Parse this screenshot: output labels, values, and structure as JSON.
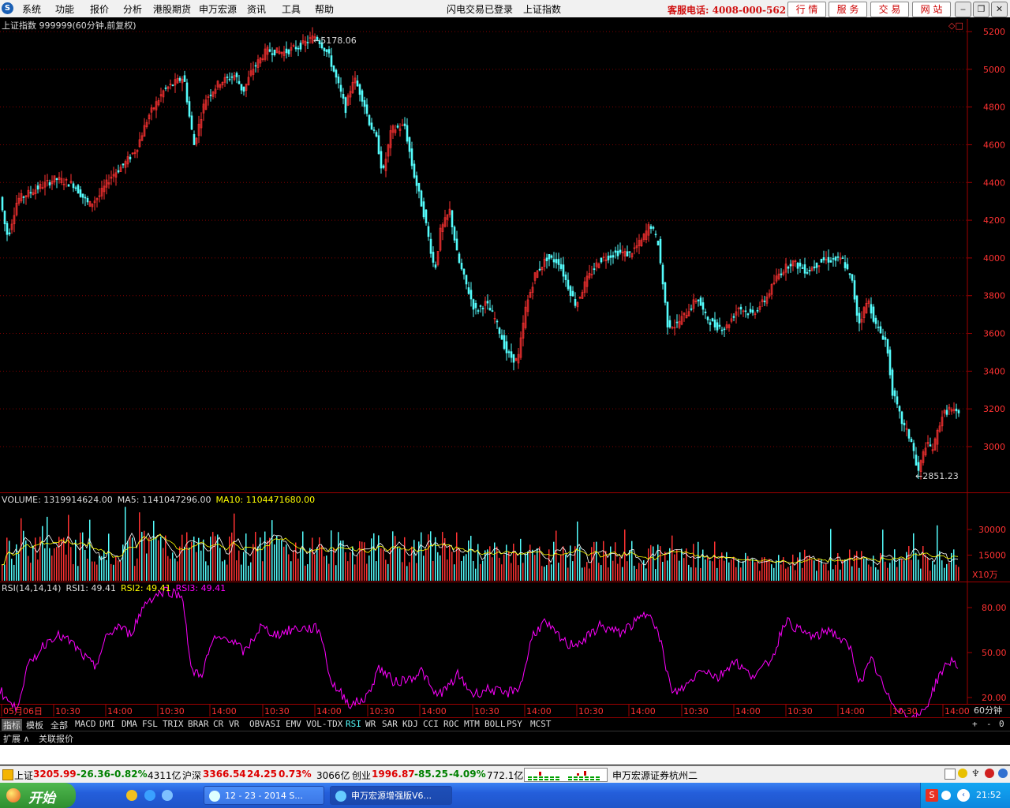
{
  "menu": {
    "items": [
      "系统",
      "功能",
      "报价",
      "分析",
      "港股期货",
      "申万宏源",
      "资讯",
      "工具",
      "帮助"
    ],
    "status_center": "闪电交易已登录",
    "current_security": "上证指数",
    "hotline": "客服电话: 4008-000-562",
    "right_buttons": [
      "行 情",
      "服 务",
      "交 易",
      "网 站"
    ]
  },
  "window_buttons": {
    "minimize": "‒",
    "restore": "❐",
    "close": "✕"
  },
  "chart": {
    "title": "上证指数 999999(60分钟,前复权)",
    "high_label": "5178.06",
    "low_label": "2851.23",
    "corner_mark": "◇□",
    "price_ticks": [
      "5200",
      "5000",
      "4800",
      "4600",
      "4400",
      "4200",
      "4000",
      "3800",
      "3600",
      "3400",
      "3200",
      "3000"
    ],
    "volume": {
      "label": "VOLUME: 1319914624.00",
      "ma5_label": "MA5: 1141047296.00",
      "ma10_label": "MA10: 1104471680.00",
      "ticks": [
        "30000",
        "15000"
      ],
      "unit": "X10万"
    },
    "rsi": {
      "label": "RSI(14,14,14)",
      "rsi1": "RSI1: 49.41",
      "rsi2": "RSI2: 49.41",
      "rsi3": "RSI3: 49.41",
      "ticks": [
        "80.00",
        "50.00",
        "20.00"
      ]
    },
    "time_labels": [
      "05月06日",
      "10:30",
      "14:00",
      "10:30",
      "14:00",
      "10:30",
      "14:00",
      "10:30",
      "14:00",
      "10:30",
      "14:00",
      "10:30",
      "14:00",
      "10:30",
      "14:00",
      "10:30",
      "14:00",
      "10:30",
      "14:00"
    ],
    "period": "60分钟"
  },
  "colors": {
    "up": "#ff3232",
    "down": "#54fcfc",
    "ma5": "#ffffff",
    "ma10": "#ffff00",
    "rsi": "#ff00ff",
    "grid": "#800000",
    "axis_text": "#ff3232"
  },
  "chart_data": {
    "type": "candlestick",
    "title": "上证指数 999999(60分钟,前复权)",
    "ylim": [
      2800,
      5250
    ],
    "price_path": [
      [
        0,
        4370
      ],
      [
        8,
        4180
      ],
      [
        12,
        4110
      ],
      [
        24,
        4310
      ],
      [
        45,
        4360
      ],
      [
        72,
        4420
      ],
      [
        95,
        4390
      ],
      [
        115,
        4280
      ],
      [
        128,
        4330
      ],
      [
        142,
        4430
      ],
      [
        160,
        4500
      ],
      [
        175,
        4580
      ],
      [
        190,
        4750
      ],
      [
        210,
        4890
      ],
      [
        235,
        4960
      ],
      [
        242,
        4750
      ],
      [
        248,
        4600
      ],
      [
        262,
        4840
      ],
      [
        280,
        4930
      ],
      [
        300,
        4970
      ],
      [
        310,
        4880
      ],
      [
        322,
        5000
      ],
      [
        340,
        5100
      ],
      [
        362,
        5090
      ],
      [
        385,
        5130
      ],
      [
        402,
        5178
      ],
      [
        418,
        5080
      ],
      [
        432,
        4900
      ],
      [
        440,
        4790
      ],
      [
        450,
        4960
      ],
      [
        462,
        4840
      ],
      [
        470,
        4720
      ],
      [
        480,
        4620
      ],
      [
        487,
        4440
      ],
      [
        498,
        4680
      ],
      [
        515,
        4700
      ],
      [
        525,
        4470
      ],
      [
        540,
        4220
      ],
      [
        553,
        3930
      ],
      [
        560,
        4140
      ],
      [
        572,
        4250
      ],
      [
        582,
        4000
      ],
      [
        592,
        3870
      ],
      [
        604,
        3720
      ],
      [
        618,
        3760
      ],
      [
        630,
        3670
      ],
      [
        645,
        3490
      ],
      [
        658,
        3450
      ],
      [
        668,
        3730
      ],
      [
        680,
        3910
      ],
      [
        695,
        4000
      ],
      [
        710,
        3980
      ],
      [
        722,
        3850
      ],
      [
        732,
        3750
      ],
      [
        745,
        3880
      ],
      [
        762,
        3990
      ],
      [
        785,
        4030
      ],
      [
        800,
        4020
      ],
      [
        815,
        4090
      ],
      [
        826,
        4180
      ],
      [
        836,
        4080
      ],
      [
        848,
        3650
      ],
      [
        858,
        3640
      ],
      [
        872,
        3710
      ],
      [
        886,
        3790
      ],
      [
        896,
        3690
      ],
      [
        908,
        3640
      ],
      [
        922,
        3630
      ],
      [
        938,
        3740
      ],
      [
        955,
        3700
      ],
      [
        972,
        3780
      ],
      [
        988,
        3910
      ],
      [
        1005,
        3980
      ],
      [
        1025,
        3930
      ],
      [
        1045,
        3990
      ],
      [
        1070,
        3990
      ],
      [
        1082,
        3870
      ],
      [
        1090,
        3650
      ],
      [
        1102,
        3780
      ],
      [
        1112,
        3640
      ],
      [
        1125,
        3560
      ],
      [
        1133,
        3290
      ],
      [
        1145,
        3130
      ],
      [
        1158,
        3020
      ],
      [
        1165,
        2851
      ],
      [
        1175,
        3010
      ],
      [
        1185,
        2990
      ],
      [
        1195,
        3160
      ],
      [
        1205,
        3200
      ],
      [
        1215,
        3170
      ]
    ],
    "volume_ticks": [
      30000,
      15000
    ],
    "rsi_path": [
      [
        0,
        25
      ],
      [
        10,
        18
      ],
      [
        20,
        12
      ],
      [
        35,
        40
      ],
      [
        55,
        55
      ],
      [
        70,
        62
      ],
      [
        90,
        57
      ],
      [
        105,
        48
      ],
      [
        120,
        40
      ],
      [
        135,
        60
      ],
      [
        150,
        68
      ],
      [
        165,
        62
      ],
      [
        185,
        84
      ],
      [
        210,
        92
      ],
      [
        232,
        87
      ],
      [
        242,
        38
      ],
      [
        255,
        35
      ],
      [
        270,
        58
      ],
      [
        290,
        60
      ],
      [
        310,
        50
      ],
      [
        330,
        67
      ],
      [
        350,
        62
      ],
      [
        375,
        66
      ],
      [
        405,
        66
      ],
      [
        420,
        30
      ],
      [
        445,
        15
      ],
      [
        465,
        20
      ],
      [
        480,
        40
      ],
      [
        500,
        30
      ],
      [
        520,
        33
      ],
      [
        535,
        38
      ],
      [
        550,
        22
      ],
      [
        565,
        25
      ],
      [
        580,
        35
      ],
      [
        600,
        22
      ],
      [
        620,
        26
      ],
      [
        640,
        22
      ],
      [
        660,
        28
      ],
      [
        675,
        62
      ],
      [
        690,
        70
      ],
      [
        705,
        62
      ],
      [
        720,
        55
      ],
      [
        740,
        58
      ],
      [
        760,
        68
      ],
      [
        785,
        63
      ],
      [
        805,
        70
      ],
      [
        825,
        78
      ],
      [
        838,
        55
      ],
      [
        852,
        22
      ],
      [
        870,
        28
      ],
      [
        890,
        40
      ],
      [
        910,
        33
      ],
      [
        930,
        45
      ],
      [
        950,
        35
      ],
      [
        965,
        38
      ],
      [
        980,
        48
      ],
      [
        995,
        72
      ],
      [
        1015,
        64
      ],
      [
        1035,
        60
      ],
      [
        1050,
        66
      ],
      [
        1065,
        59
      ],
      [
        1078,
        52
      ],
      [
        1090,
        30
      ],
      [
        1105,
        45
      ],
      [
        1125,
        20
      ],
      [
        1145,
        10
      ],
      [
        1160,
        5
      ],
      [
        1175,
        15
      ],
      [
        1190,
        35
      ],
      [
        1205,
        45
      ],
      [
        1215,
        42
      ]
    ]
  },
  "indicator_tabs": [
    "指标",
    "模板",
    "全部",
    "MACD",
    "DMI",
    "DMA",
    "FSL",
    "TRIX",
    "BRAR",
    "CR",
    "VR",
    "OBV",
    "ASI",
    "EMV",
    "VOL-TDX",
    "RSI",
    "WR",
    "SAR",
    "KDJ",
    "CCI",
    "ROC",
    "MTM",
    "BOLL",
    "PSY",
    "MCST"
  ],
  "tab_controls": [
    "+",
    "-",
    "0"
  ],
  "ext_tabs": [
    "扩展 ∧",
    "关联报价"
  ],
  "statusbar": {
    "sh_name": "上证",
    "sh_value": "3205.99",
    "sh_change": "-26.36",
    "sh_pct": "-0.82%",
    "sh_amount": "4311亿",
    "hs_name": "沪深",
    "hs_value": "3366.54",
    "hs_change": "24.25",
    "hs_pct": "0.73%",
    "hs_amount": "3066亿",
    "cy_name": "创业",
    "cy_value": "1996.87",
    "cy_change": "-85.25",
    "cy_pct": "-4.09%",
    "cy_amount": "772.1亿",
    "branch": "申万宏源证券杭州二"
  },
  "taskbar": {
    "start": "开始",
    "tasks": [
      "12 - 23 - 2014 S...",
      "申万宏源增强版V6..."
    ],
    "clock": "21:52"
  }
}
